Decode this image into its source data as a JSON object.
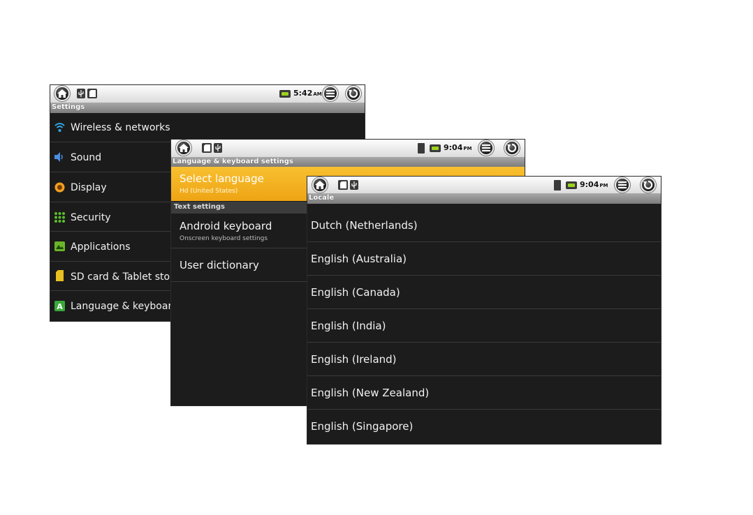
{
  "settings_screen": {
    "time": "5:42",
    "ampm": "AM",
    "title": "Settings",
    "items": [
      {
        "label": "Wireless & networks"
      },
      {
        "label": "Sound"
      },
      {
        "label": "Display"
      },
      {
        "label": "Security"
      },
      {
        "label": "Applications"
      },
      {
        "label": "SD card & Tablet stora"
      },
      {
        "label": "Language & keyboard"
      }
    ]
  },
  "language_screen": {
    "time": "9:04",
    "ampm": "PM",
    "title": "Language & keyboard settings",
    "selected": {
      "label": "Select language",
      "sublabel": "Hd (United States)"
    },
    "section": "Text settings",
    "items": [
      {
        "label": "Android keyboard",
        "sublabel": "Onscreen keyboard settings"
      },
      {
        "label": "User dictionary"
      }
    ]
  },
  "locale_screen": {
    "time": "9:04",
    "ampm": "PM",
    "title": "Locale",
    "items": [
      "Dutch (Netherlands)",
      "English (Australia)",
      "English (Canada)",
      "English (India)",
      "English (Ireland)",
      "English (New Zealand)",
      "English (Singapore)"
    ]
  },
  "colors": {
    "highlight": "#f5b21a",
    "wifi": "#2ea8e8",
    "sound": "#4a8ee0",
    "display": "#f0a020",
    "security": "#5cc02a",
    "applications": "#6bb52a",
    "sdcard": "#e8c020",
    "language": "#3aa83a"
  },
  "icons": {
    "home": "home-icon",
    "menu": "menu-icon",
    "back": "back-icon",
    "usb": "usb-icon",
    "sdcard": "sdcard-icon",
    "battery": "battery-icon"
  }
}
